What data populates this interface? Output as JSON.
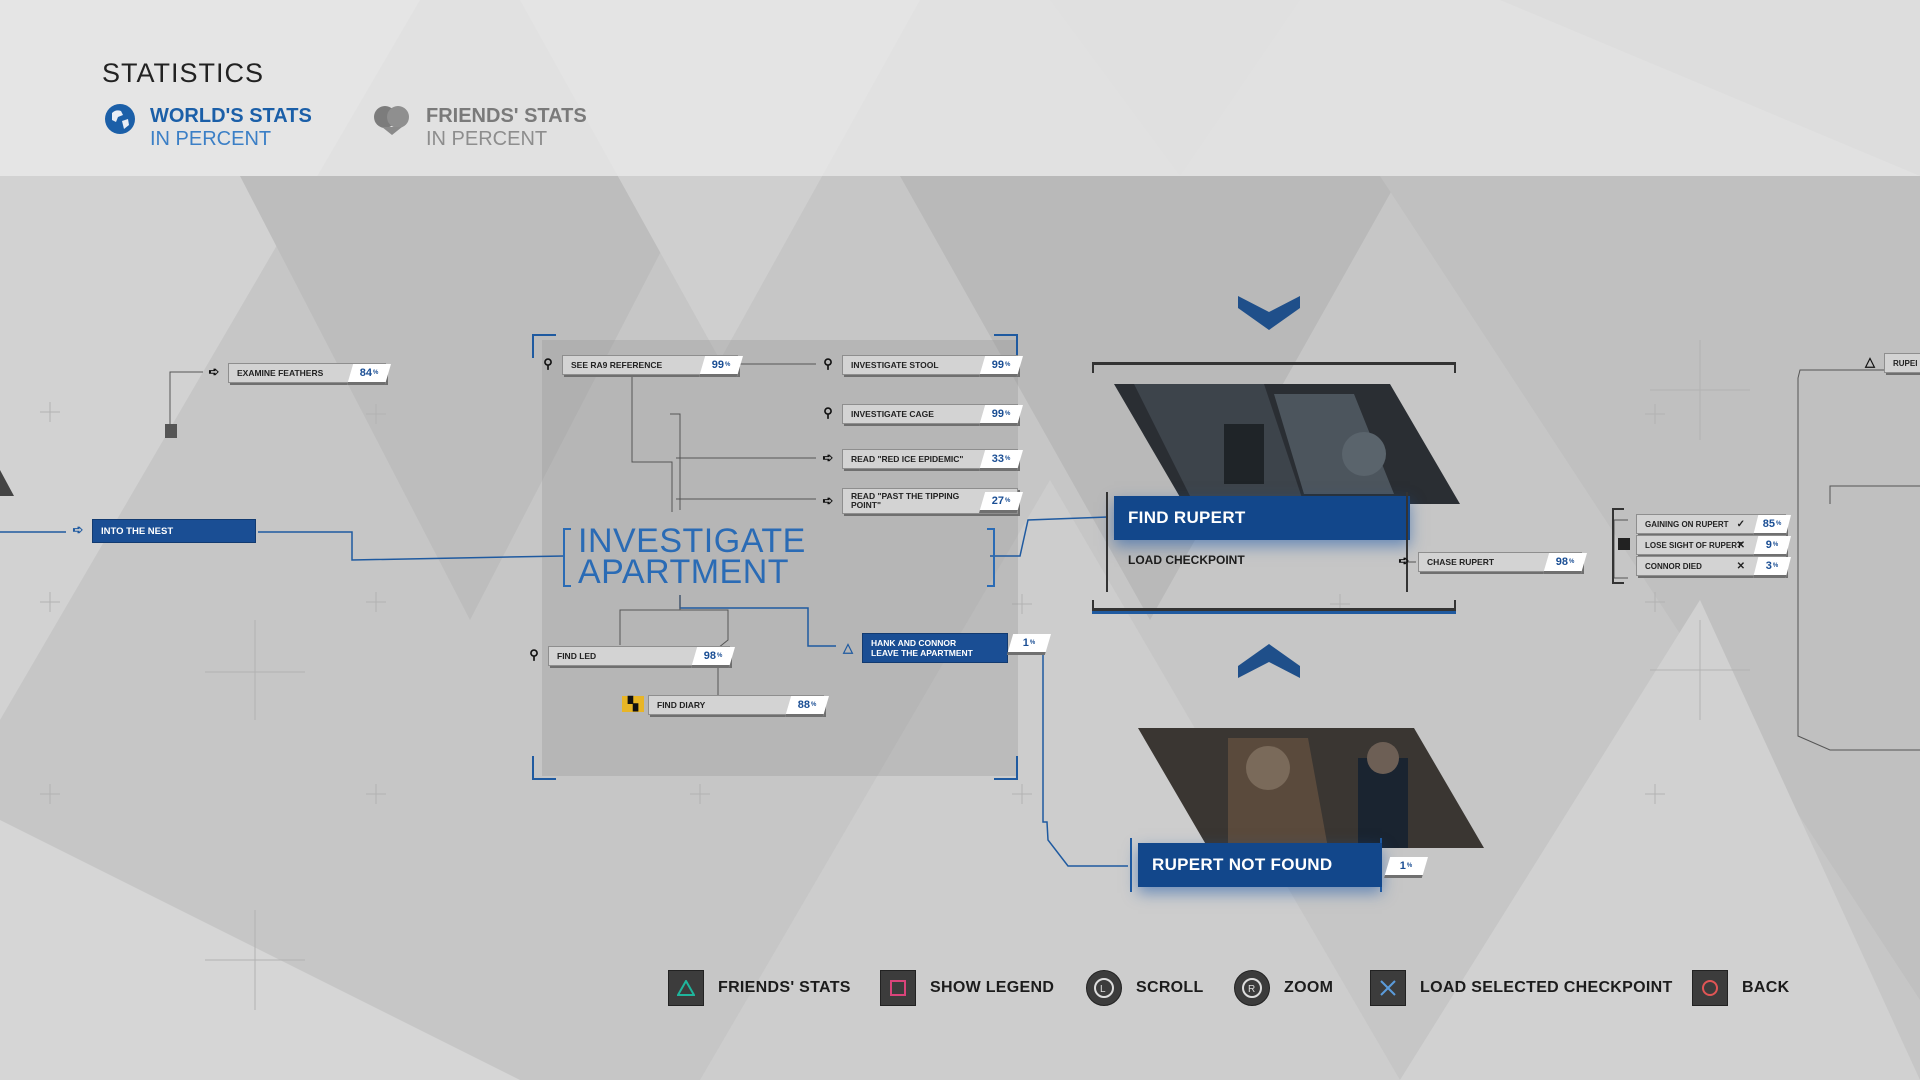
{
  "header": {
    "title": "STATISTICS",
    "world_tab": {
      "label": "WORLD'S STATS",
      "sub": "IN PERCENT"
    },
    "friends_tab": {
      "label": "FRIENDS' STATS",
      "sub": "IN PERCENT"
    }
  },
  "graph": {
    "examine_feathers": {
      "label": "EXAMINE FEATHERS",
      "pct": "84"
    },
    "into_the_nest": {
      "label": "INTO THE NEST"
    },
    "investigate_apartment": {
      "line1": "INVESTIGATE",
      "line2": "APARTMENT"
    },
    "see_ra9": {
      "label": "SEE RA9 REFERENCE",
      "pct": "99"
    },
    "investigate_stool": {
      "label": "INVESTIGATE STOOL",
      "pct": "99"
    },
    "investigate_cage": {
      "label": "INVESTIGATE CAGE",
      "pct": "99"
    },
    "read_red_ice": {
      "label": "READ \"RED ICE EPIDEMIC\"",
      "pct": "33"
    },
    "read_tipping": {
      "label": "READ \"PAST THE TIPPING POINT\"",
      "pct": "27"
    },
    "find_led": {
      "label": "FIND LED",
      "pct": "98"
    },
    "find_diary": {
      "label": "FIND DIARY",
      "pct": "88"
    },
    "hank_connor": {
      "label": "HANK AND CONNOR LEAVE THE APARTMENT",
      "pct": "1"
    },
    "find_rupert": {
      "label": "FIND RUPERT",
      "load": "LOAD CHECKPOINT"
    },
    "chase_rupert": {
      "label": "CHASE RUPERT",
      "pct": "98"
    },
    "gaining": {
      "label": "GAINING ON RUPERT",
      "pct": "85"
    },
    "lose_sight": {
      "label": "LOSE SIGHT OF RUPERT",
      "pct": "9"
    },
    "connor_died": {
      "label": "CONNOR DIED",
      "pct": "3"
    },
    "rupert_not_found": {
      "label": "RUPERT NOT FOUND",
      "pct": "1"
    },
    "rupert_edge": {
      "label": "RUPEI"
    },
    "pct_suffix": "%"
  },
  "footer": {
    "friends_stats": "FRIENDS' STATS",
    "show_legend": "SHOW LEGEND",
    "scroll": "SCROLL",
    "zoom": "ZOOM",
    "load_selected": "LOAD SELECTED CHECKPOINT",
    "back": "BACK"
  },
  "colors": {
    "accent": "#1a4e94",
    "highlight": "#e8b526",
    "triangle": "#1fb59c",
    "square": "#d9447a"
  }
}
